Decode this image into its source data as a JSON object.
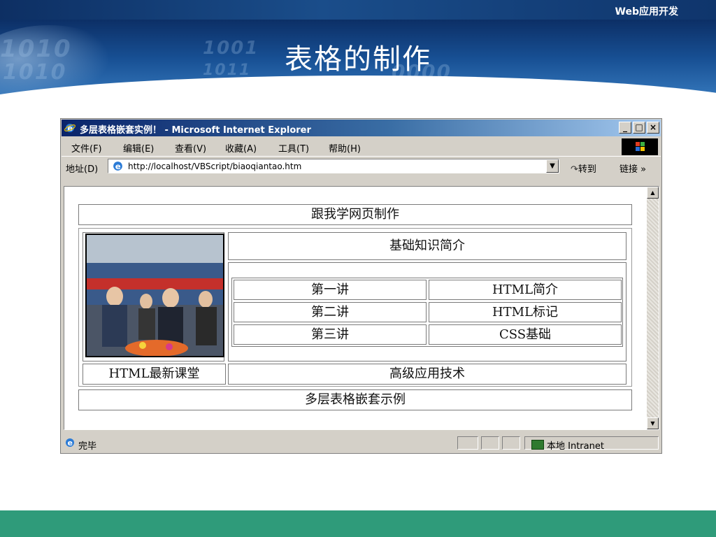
{
  "slide": {
    "brand": "Web应用开发",
    "title": "表格的制作"
  },
  "window": {
    "title": "多层表格嵌套实例！ - Microsoft Internet Explorer",
    "controls": {
      "minimize": "_",
      "maximize": "□",
      "close": "×"
    },
    "menu": [
      "文件(F)",
      "编辑(E)",
      "查看(V)",
      "收藏(A)",
      "工具(T)",
      "帮助(H)"
    ],
    "address_label": "地址(D)",
    "url": "http://localhost/VBScript/biaoqiantao.htm",
    "go_label": "转到",
    "links_label": "链接 »",
    "status_text": "完毕",
    "zone_text": "本地 Intranet"
  },
  "page": {
    "top_row": "跟我学网页制作",
    "section_title": "基础知识简介",
    "lessons": [
      {
        "num": "第一讲",
        "topic": "HTML简介"
      },
      {
        "num": "第二讲",
        "topic": "HTML标记"
      },
      {
        "num": "第三讲",
        "topic": "CSS基础"
      }
    ],
    "left_caption": "HTML最新课堂",
    "right_caption": "高级应用技术",
    "bottom_row": "多层表格嵌套示例"
  }
}
